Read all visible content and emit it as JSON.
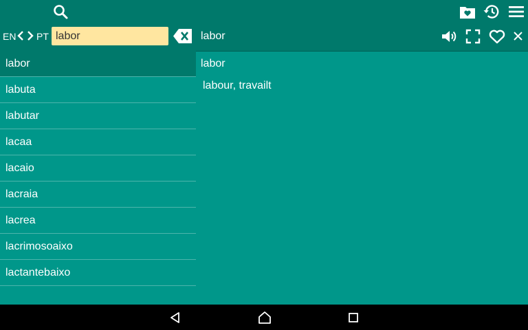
{
  "toolbar": {
    "icons": [
      "search-icon",
      "folder-heart-icon",
      "history-icon",
      "menu-icon"
    ]
  },
  "languages": {
    "from": "EN",
    "to": "PT"
  },
  "search": {
    "value": "labor"
  },
  "detail": {
    "header_word": "labor",
    "headword": "labor",
    "definition": "labour, travailt"
  },
  "word_list": [
    "labor",
    "labuta",
    "labutar",
    "lacaa",
    "lacaio",
    "lacraia",
    "lacrea",
    "lacrimosoaixo",
    "lactantebaixo"
  ],
  "selected_index": 0,
  "colors": {
    "toolbar": "#00796b",
    "background": "#00978a",
    "search_field": "#ffe6a0",
    "nav_bar": "#000000"
  }
}
